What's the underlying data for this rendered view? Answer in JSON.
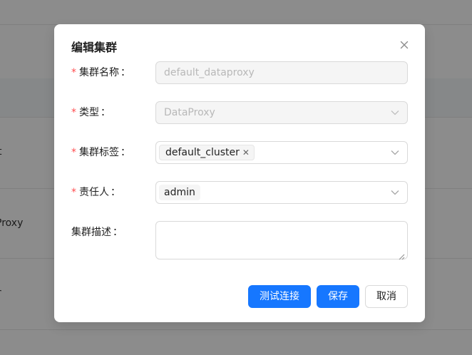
{
  "background": {
    "row_cells": [
      "t",
      "Proxy",
      "r"
    ]
  },
  "modal": {
    "title": "编辑集群",
    "close_icon": "close-icon",
    "fields": {
      "name": {
        "label": "集群名称",
        "required": true,
        "value": "default_dataproxy",
        "disabled": true
      },
      "type": {
        "label": "类型",
        "required": true,
        "value": "DataProxy",
        "disabled": true
      },
      "tags": {
        "label": "集群标签",
        "required": true,
        "values": [
          "default_cluster"
        ]
      },
      "owner": {
        "label": "责任人",
        "required": true,
        "values": [
          "admin"
        ]
      },
      "description": {
        "label": "集群描述",
        "required": false,
        "value": ""
      }
    },
    "required_mark": "*",
    "label_suffix": "：",
    "buttons": {
      "test": "测试连接",
      "save": "保存",
      "cancel": "取消"
    }
  },
  "colors": {
    "primary": "#1677ff",
    "required": "#ff4d4f",
    "overlay": "rgba(0,0,0,0.45)"
  }
}
